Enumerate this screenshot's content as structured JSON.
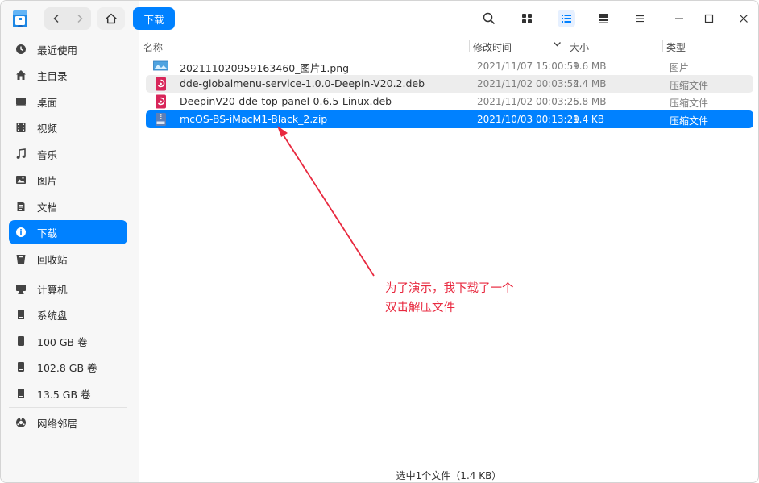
{
  "toolbar": {
    "crumb_current": "下载"
  },
  "sidebar": {
    "items": [
      {
        "label": "最近使用",
        "icon": "clock-icon"
      },
      {
        "label": "主目录",
        "icon": "home-icon"
      },
      {
        "label": "桌面",
        "icon": "desktop-icon"
      },
      {
        "label": "视频",
        "icon": "video-icon"
      },
      {
        "label": "音乐",
        "icon": "music-icon"
      },
      {
        "label": "图片",
        "icon": "picture-icon"
      },
      {
        "label": "文档",
        "icon": "document-icon"
      },
      {
        "label": "下载",
        "icon": "download-icon",
        "active": true
      },
      {
        "label": "回收站",
        "icon": "trash-icon"
      },
      {
        "label": "计算机",
        "icon": "computer-icon"
      },
      {
        "label": "系统盘",
        "icon": "disk-icon"
      },
      {
        "label": "100 GB 卷",
        "icon": "disk-icon"
      },
      {
        "label": "102.8 GB 卷",
        "icon": "disk-icon"
      },
      {
        "label": "13.5 GB 卷",
        "icon": "disk-icon"
      },
      {
        "label": "网络邻居",
        "icon": "network-icon"
      }
    ]
  },
  "columns": {
    "name": "名称",
    "modified": "修改时间",
    "size": "大小",
    "type": "类型"
  },
  "files": [
    {
      "name": "202111020959163460_图片1.png",
      "modified": "2021/11/07 15:00:59",
      "size": "1.6 MB",
      "type": "图片",
      "icon": "image-file-icon"
    },
    {
      "name": "dde-globalmenu-service-1.0.0-Deepin-V20.2.deb",
      "modified": "2021/11/02 00:03:54",
      "size": "2.4 MB",
      "type": "压缩文件",
      "icon": "deb-package-icon"
    },
    {
      "name": "DeepinV20-dde-top-panel-0.6.5-Linux.deb",
      "modified": "2021/11/02 00:03:25",
      "size": "6.8 MB",
      "type": "压缩文件",
      "icon": "deb-package-icon"
    },
    {
      "name": "mcOS-BS-iMacM1-Black_2.zip",
      "modified": "2021/10/03 00:13:29",
      "size": "1.4 KB",
      "type": "压缩文件",
      "icon": "zip-archive-icon",
      "selected": true
    }
  ],
  "annotation": {
    "line1": "为了演示，我下载了一个",
    "line2": "双击解压文件",
    "color": "#e8293f"
  },
  "status": {
    "text": "选中1个文件（1.4 KB）"
  },
  "colors": {
    "accent": "#0081ff",
    "sidebar_bg": "#f7f7f7"
  }
}
